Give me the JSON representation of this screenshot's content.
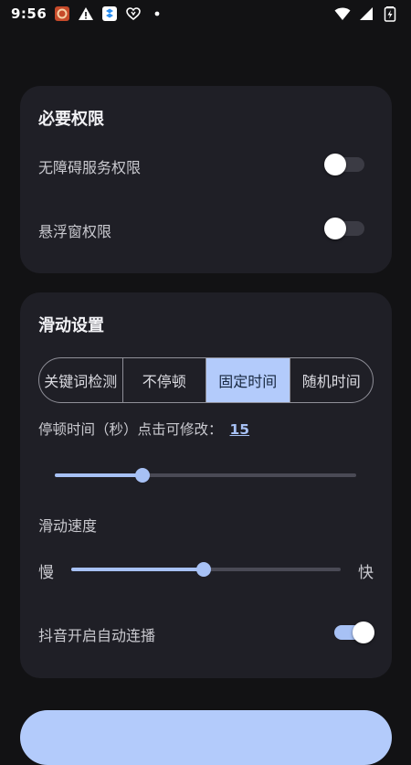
{
  "status_bar": {
    "time": "9:56",
    "left_icons": [
      "app-notification-icon",
      "warning-icon",
      "dropbox-icon",
      "heart-icon",
      "dot-icon"
    ],
    "right_icons": [
      "wifi-icon",
      "signal-icon",
      "battery-icon"
    ]
  },
  "permissions": {
    "title": "必要权限",
    "items": [
      {
        "label": "无障碍服务权限",
        "enabled": false
      },
      {
        "label": "悬浮窗权限",
        "enabled": false
      }
    ]
  },
  "scroll_settings": {
    "title": "滑动设置",
    "modes": [
      "关键词检测",
      "不停顿",
      "固定时间",
      "随机时间"
    ],
    "selected_mode": "固定时间",
    "pause": {
      "label": "停顿时间（秒）点击可修改：",
      "value": "15",
      "slider_fraction": 0.29
    },
    "speed": {
      "label": "滑动速度",
      "min_label": "慢",
      "max_label": "快",
      "slider_fraction": 0.49
    },
    "autoplay": {
      "label": "抖音开启自动连播",
      "enabled": true
    }
  },
  "colors": {
    "accent": "#a7c1f5",
    "selected_segment": "#b3cbfb",
    "card": "#1f1f26",
    "background": "#121214"
  }
}
